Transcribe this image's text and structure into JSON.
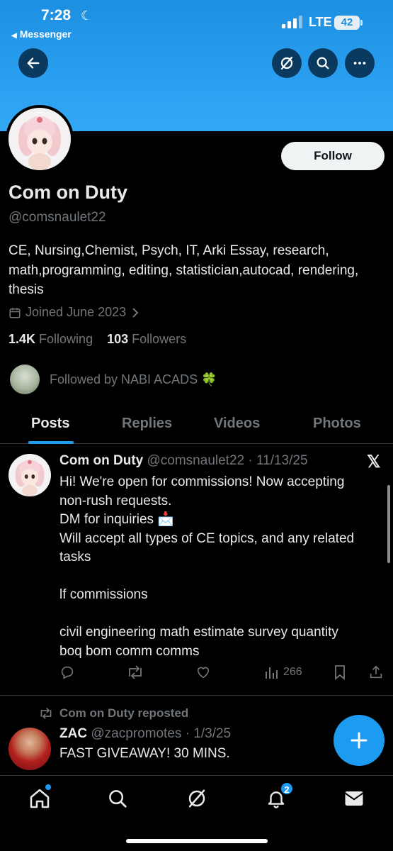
{
  "status_bar": {
    "time": "7:28",
    "back_app": "Messenger",
    "network": "LTE",
    "battery": "42"
  },
  "header": {
    "back_icon": "arrow-left-icon",
    "grok_icon": "grok-icon",
    "search_icon": "search-icon",
    "more_icon": "more-horizontal-icon"
  },
  "profile": {
    "follow_label": "Follow",
    "display_name": "Com on Duty",
    "handle": "@comsnaulet22",
    "bio": "CE, Nursing,Chemist, Psych, IT, Arki Essay, research, math,programming, editing, statistician,autocad, rendering, thesis",
    "joined": "Joined June 2023",
    "following_count": "1.4K",
    "following_label": "Following",
    "followers_count": "103",
    "followers_label": "Followers",
    "followed_by": "Followed by NABI ACADS 🍀"
  },
  "tabs": [
    {
      "label": "Posts",
      "active": true
    },
    {
      "label": "Replies",
      "active": false
    },
    {
      "label": "Videos",
      "active": false
    },
    {
      "label": "Photos",
      "active": false
    }
  ],
  "post": {
    "name": "Com on Duty",
    "meta": "@comsnaulet22 · 11/13/25",
    "lines": [
      "Hi! We're open for commissions! Now accepting",
      "non-rush requests.",
      "DM for inquiries 📩",
      "Will accept all types of CE topics, and any related",
      "tasks",
      "",
      "lf commissions",
      "",
      "civil engineering math estimate survey quantity",
      "boq bom comm comms"
    ],
    "views": "266"
  },
  "repost": {
    "label": "Com on Duty reposted",
    "name": "ZAC",
    "meta": "@zacpromotes · 1/3/25",
    "text": "FAST GIVEAWAY!  30 MINS."
  },
  "bottom_nav": {
    "notifications_badge": "2"
  },
  "colors": {
    "accent": "#1d9bf0",
    "banner": "#2a9ff0",
    "text": "#e7e9ea",
    "muted": "#71767b"
  }
}
